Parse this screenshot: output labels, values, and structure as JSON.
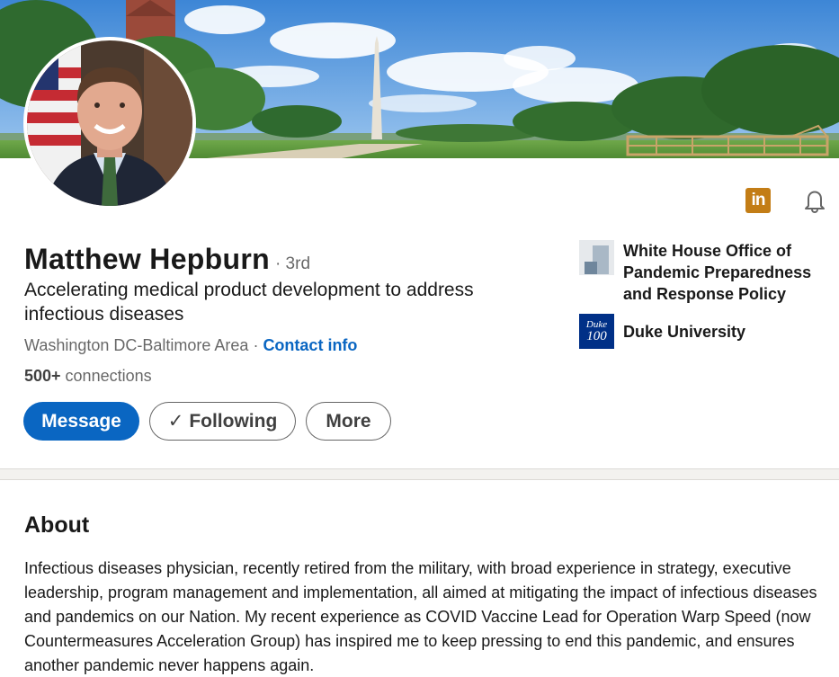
{
  "profile": {
    "name": "Matthew Hepburn",
    "degree": "· 3rd",
    "headline": "Accelerating medical product development to address infectious diseases",
    "location": "Washington DC-Baltimore Area",
    "separator": " · ",
    "contact_label": "Contact info",
    "connections_count": "500+",
    "connections_label": " connections"
  },
  "header_icons": {
    "linkedin_logo": "in",
    "linkedin_icon": "linkedin-icon",
    "bell_icon": "bell-icon"
  },
  "actions": {
    "message_label": "Message",
    "following_label": "Following",
    "following_check": "✓",
    "more_label": "More"
  },
  "organizations": [
    {
      "name": "White House Office of Pandemic Preparedness and Response Policy"
    },
    {
      "name": "Duke University",
      "logo_line1": "Duke",
      "logo_line2": "100"
    }
  ],
  "about": {
    "title": "About",
    "text": "Infectious diseases physician, recently retired from the military, with broad experience in strategy, executive leadership, program management and implementation, all aimed at mitigating the impact of infectious diseases and pandemics on our Nation. My recent experience as COVID Vaccine Lead for Operation Warp Speed (now Countermeasures Acceleration Group) has inspired me to keep pressing to end this pandemic, and ensures another pandemic never happens again."
  },
  "colors": {
    "primary_blue": "#0a66c2",
    "linkedin_gold": "#c37d16",
    "duke_blue": "#003087"
  }
}
